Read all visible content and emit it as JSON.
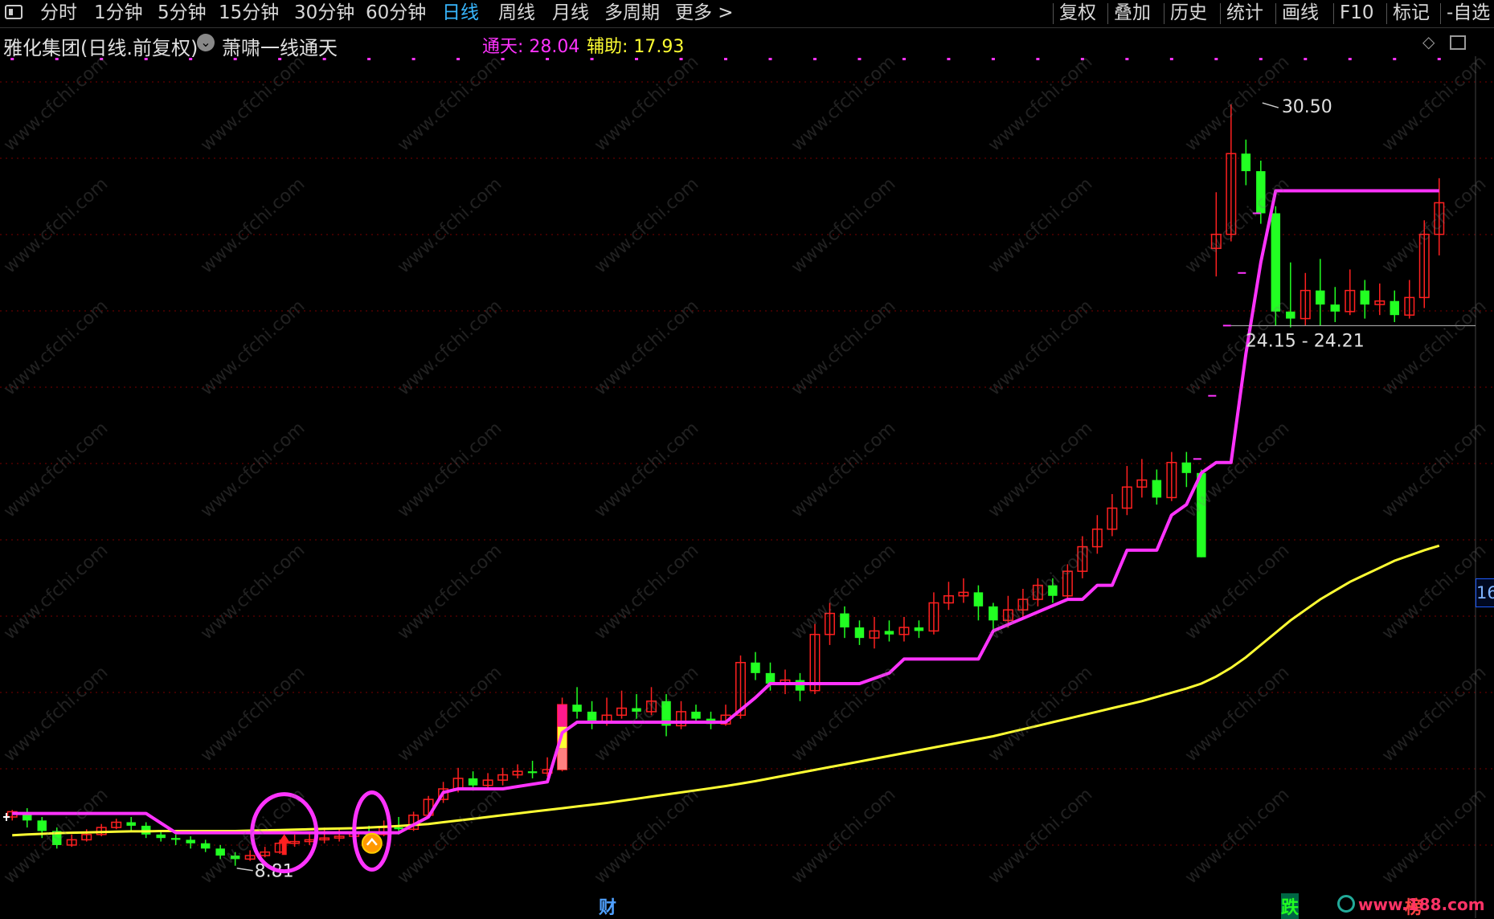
{
  "toolbar": {
    "periods": [
      "分时",
      "1分钟",
      "5分钟",
      "15分钟",
      "30分钟",
      "60分钟",
      "日线",
      "周线",
      "月线",
      "多周期",
      "更多 >"
    ],
    "active_period": "日线",
    "right_buttons": [
      "复权",
      "叠加",
      "历史",
      "统计",
      "画线",
      "F10",
      "标记",
      "-自选"
    ]
  },
  "header": {
    "stock": "雅化集团(日线.前复权)",
    "indicator": "萧啸一线通天",
    "tongtian_label": "通天: 28.04",
    "fuzhu_label": "辅助: 17.93",
    "colors": {
      "tongtian": "#ff33ff",
      "fuzhu": "#ffff33",
      "stock": "#e0e0e0"
    }
  },
  "annotations": {
    "high_label": "30.50",
    "low_label": "8.81",
    "range_label": "24.15 - 24.21",
    "right_tag": "16",
    "bottom_cai": "财",
    "bottom_die": "跌",
    "bottom_bang": "榜",
    "logo_text": "www.188.com"
  },
  "watermark": "www.cfchi.com",
  "colors": {
    "up": "#ff2020",
    "down": "#22ff22",
    "tongtian_line": "#ff33ff",
    "fuzhu_line": "#ffff33",
    "grid": "#7a0000",
    "circle": "#ff33ff"
  },
  "chart_data": {
    "type": "candlestick",
    "price_range": [
      8.81,
      30.5
    ],
    "high": 30.5,
    "low": 8.81,
    "candles": [
      {
        "o": 10.2,
        "c": 10.35,
        "h": 10.4,
        "l": 10.1
      },
      {
        "o": 10.3,
        "c": 10.1,
        "h": 10.45,
        "l": 9.9
      },
      {
        "o": 10.1,
        "c": 9.8,
        "h": 10.2,
        "l": 9.6
      },
      {
        "o": 9.8,
        "c": 9.4,
        "h": 9.9,
        "l": 9.3
      },
      {
        "o": 9.4,
        "c": 9.55,
        "h": 9.7,
        "l": 9.35
      },
      {
        "o": 9.55,
        "c": 9.7,
        "h": 9.85,
        "l": 9.5
      },
      {
        "o": 9.7,
        "c": 9.9,
        "h": 10.0,
        "l": 9.65
      },
      {
        "o": 9.9,
        "c": 10.05,
        "h": 10.15,
        "l": 9.85
      },
      {
        "o": 10.05,
        "c": 9.95,
        "h": 10.2,
        "l": 9.8
      },
      {
        "o": 9.95,
        "c": 9.7,
        "h": 10.05,
        "l": 9.6
      },
      {
        "o": 9.7,
        "c": 9.6,
        "h": 9.8,
        "l": 9.5
      },
      {
        "o": 9.6,
        "c": 9.55,
        "h": 9.7,
        "l": 9.4
      },
      {
        "o": 9.55,
        "c": 9.45,
        "h": 9.65,
        "l": 9.3
      },
      {
        "o": 9.45,
        "c": 9.3,
        "h": 9.55,
        "l": 9.2
      },
      {
        "o": 9.3,
        "c": 9.1,
        "h": 9.4,
        "l": 9.0
      },
      {
        "o": 9.1,
        "c": 9.0,
        "h": 9.2,
        "l": 8.81
      },
      {
        "o": 9.0,
        "c": 9.1,
        "h": 9.25,
        "l": 8.95
      },
      {
        "o": 9.1,
        "c": 9.2,
        "h": 9.35,
        "l": 9.05
      },
      {
        "o": 9.2,
        "c": 9.45,
        "h": 9.55,
        "l": 9.15
      },
      {
        "o": 9.45,
        "c": 9.5,
        "h": 9.7,
        "l": 9.35
      },
      {
        "o": 9.5,
        "c": 9.55,
        "h": 9.75,
        "l": 9.4
      },
      {
        "o": 9.55,
        "c": 9.6,
        "h": 9.9,
        "l": 9.45
      },
      {
        "o": 9.6,
        "c": 9.65,
        "h": 9.85,
        "l": 9.5
      },
      {
        "o": 9.65,
        "c": 9.75,
        "h": 9.95,
        "l": 9.55
      },
      {
        "o": 9.75,
        "c": 9.7,
        "h": 9.95,
        "l": 9.6
      },
      {
        "o": 9.7,
        "c": 9.9,
        "h": 10.1,
        "l": 9.65
      },
      {
        "o": 9.9,
        "c": 9.85,
        "h": 10.2,
        "l": 9.7
      },
      {
        "o": 9.85,
        "c": 10.25,
        "h": 10.35,
        "l": 9.8
      },
      {
        "o": 10.25,
        "c": 10.7,
        "h": 10.8,
        "l": 10.2
      },
      {
        "o": 10.7,
        "c": 11.0,
        "h": 11.2,
        "l": 10.6
      },
      {
        "o": 11.0,
        "c": 11.3,
        "h": 11.6,
        "l": 10.9
      },
      {
        "o": 11.3,
        "c": 11.1,
        "h": 11.5,
        "l": 10.95
      },
      {
        "o": 11.1,
        "c": 11.25,
        "h": 11.45,
        "l": 11.0
      },
      {
        "o": 11.25,
        "c": 11.4,
        "h": 11.6,
        "l": 11.1
      },
      {
        "o": 11.4,
        "c": 11.5,
        "h": 11.7,
        "l": 11.3
      },
      {
        "o": 11.5,
        "c": 11.45,
        "h": 11.8,
        "l": 11.3
      },
      {
        "o": 11.45,
        "c": 11.55,
        "h": 11.9,
        "l": 11.35
      },
      {
        "o": 11.55,
        "c": 13.4,
        "h": 13.6,
        "l": 11.5
      },
      {
        "o": 13.4,
        "c": 13.2,
        "h": 13.9,
        "l": 13.0
      },
      {
        "o": 13.2,
        "c": 12.9,
        "h": 13.5,
        "l": 12.7
      },
      {
        "o": 12.9,
        "c": 13.1,
        "h": 13.6,
        "l": 12.8
      },
      {
        "o": 13.1,
        "c": 13.3,
        "h": 13.8,
        "l": 13.0
      },
      {
        "o": 13.3,
        "c": 13.2,
        "h": 13.7,
        "l": 13.0
      },
      {
        "o": 13.2,
        "c": 13.5,
        "h": 13.9,
        "l": 13.1
      },
      {
        "o": 13.5,
        "c": 12.8,
        "h": 13.7,
        "l": 12.5
      },
      {
        "o": 12.8,
        "c": 13.2,
        "h": 13.5,
        "l": 12.7
      },
      {
        "o": 13.2,
        "c": 13.0,
        "h": 13.4,
        "l": 12.9
      },
      {
        "o": 13.0,
        "c": 12.85,
        "h": 13.2,
        "l": 12.7
      },
      {
        "o": 12.85,
        "c": 13.1,
        "h": 13.4,
        "l": 12.8
      },
      {
        "o": 13.1,
        "c": 14.6,
        "h": 14.8,
        "l": 13.0
      },
      {
        "o": 14.6,
        "c": 14.3,
        "h": 14.9,
        "l": 14.1
      },
      {
        "o": 14.3,
        "c": 14.0,
        "h": 14.6,
        "l": 13.8
      },
      {
        "o": 14.0,
        "c": 14.1,
        "h": 14.4,
        "l": 13.7
      },
      {
        "o": 14.1,
        "c": 13.8,
        "h": 14.3,
        "l": 13.5
      },
      {
        "o": 13.8,
        "c": 15.4,
        "h": 15.7,
        "l": 13.7
      },
      {
        "o": 15.4,
        "c": 16.0,
        "h": 16.3,
        "l": 15.1
      },
      {
        "o": 16.0,
        "c": 15.6,
        "h": 16.2,
        "l": 15.3
      },
      {
        "o": 15.6,
        "c": 15.3,
        "h": 15.8,
        "l": 15.1
      },
      {
        "o": 15.3,
        "c": 15.5,
        "h": 15.9,
        "l": 15.0
      },
      {
        "o": 15.5,
        "c": 15.4,
        "h": 15.8,
        "l": 15.2
      },
      {
        "o": 15.4,
        "c": 15.6,
        "h": 15.9,
        "l": 15.2
      },
      {
        "o": 15.6,
        "c": 15.5,
        "h": 15.8,
        "l": 15.3
      },
      {
        "o": 15.5,
        "c": 16.3,
        "h": 16.6,
        "l": 15.4
      },
      {
        "o": 16.3,
        "c": 16.5,
        "h": 16.9,
        "l": 16.1
      },
      {
        "o": 16.5,
        "c": 16.6,
        "h": 17.0,
        "l": 16.3
      },
      {
        "o": 16.6,
        "c": 16.2,
        "h": 16.8,
        "l": 15.8
      },
      {
        "o": 16.2,
        "c": 15.8,
        "h": 16.3,
        "l": 15.5
      },
      {
        "o": 15.8,
        "c": 16.1,
        "h": 16.5,
        "l": 15.6
      },
      {
        "o": 16.1,
        "c": 16.4,
        "h": 16.7,
        "l": 15.9
      },
      {
        "o": 16.4,
        "c": 16.8,
        "h": 17.0,
        "l": 16.2
      },
      {
        "o": 16.8,
        "c": 16.5,
        "h": 17.0,
        "l": 16.3
      },
      {
        "o": 16.5,
        "c": 17.2,
        "h": 17.4,
        "l": 16.4
      },
      {
        "o": 17.2,
        "c": 17.9,
        "h": 18.2,
        "l": 17.0
      },
      {
        "o": 17.9,
        "c": 18.4,
        "h": 18.8,
        "l": 17.7
      },
      {
        "o": 18.4,
        "c": 19.0,
        "h": 19.4,
        "l": 18.2
      },
      {
        "o": 19.0,
        "c": 19.6,
        "h": 20.2,
        "l": 18.8
      },
      {
        "o": 19.6,
        "c": 19.8,
        "h": 20.4,
        "l": 19.3
      },
      {
        "o": 19.8,
        "c": 19.3,
        "h": 20.1,
        "l": 19.1
      },
      {
        "o": 19.3,
        "c": 20.3,
        "h": 20.6,
        "l": 19.2
      },
      {
        "o": 20.3,
        "c": 20.0,
        "h": 20.6,
        "l": 19.6
      },
      {
        "o": 20.0,
        "c": 17.6,
        "h": 20.1,
        "l": 17.6
      },
      {
        "o": 26.4,
        "c": 26.8,
        "h": 28.0,
        "l": 25.6
      },
      {
        "o": 26.8,
        "c": 29.1,
        "h": 30.5,
        "l": 26.6
      },
      {
        "o": 29.1,
        "c": 28.6,
        "h": 29.5,
        "l": 28.2
      },
      {
        "o": 28.6,
        "c": 27.4,
        "h": 28.9,
        "l": 27.1
      },
      {
        "o": 27.4,
        "c": 24.6,
        "h": 27.6,
        "l": 24.2
      },
      {
        "o": 24.6,
        "c": 24.4,
        "h": 26.0,
        "l": 24.15
      },
      {
        "o": 24.4,
        "c": 25.2,
        "h": 25.7,
        "l": 24.21
      },
      {
        "o": 25.2,
        "c": 24.8,
        "h": 26.1,
        "l": 24.2
      },
      {
        "o": 24.8,
        "c": 24.6,
        "h": 25.3,
        "l": 24.3
      },
      {
        "o": 24.6,
        "c": 25.2,
        "h": 25.8,
        "l": 24.5
      },
      {
        "o": 25.2,
        "c": 24.8,
        "h": 25.5,
        "l": 24.4
      },
      {
        "o": 24.8,
        "c": 24.9,
        "h": 25.4,
        "l": 24.5
      },
      {
        "o": 24.9,
        "c": 24.5,
        "h": 25.2,
        "l": 24.3
      },
      {
        "o": 24.5,
        "c": 25.0,
        "h": 25.5,
        "l": 24.4
      },
      {
        "o": 25.0,
        "c": 26.8,
        "h": 27.2,
        "l": 24.7
      },
      {
        "o": 26.8,
        "c": 27.7,
        "h": 28.4,
        "l": 26.2
      }
    ],
    "series": [
      {
        "name": "通天",
        "color": "#ff33ff",
        "values": [
          10.3,
          10.3,
          10.3,
          10.3,
          10.3,
          10.3,
          10.3,
          10.3,
          10.3,
          10.3,
          10.3,
          10.3,
          10.3,
          10.3,
          10.3,
          10.3,
          10.3,
          10.3,
          9.75,
          9.75,
          9.75,
          9.75,
          9.75,
          9.75,
          9.75,
          9.75,
          9.75,
          9.75,
          9.75,
          9.75,
          9.75,
          9.75,
          9.75,
          9.75,
          9.75,
          9.75,
          9.75,
          9.75,
          9.75,
          9.75,
          9.75,
          9.75,
          9.75,
          9.75,
          9.75,
          9.75,
          9.75,
          9.75,
          9.75,
          9.75,
          9.75,
          9.75,
          9.75,
          9.75,
          9.75,
          9.75,
          9.75,
          9.75,
          9.75,
          9.75,
          9.75,
          9.75,
          9.75,
          9.75,
          9.75,
          9.75,
          9.75,
          9.75,
          9.75,
          9.75,
          9.75,
          9.75,
          9.75,
          9.75,
          9.75,
          9.75,
          9.75,
          9.75,
          9.75,
          9.75,
          9.75,
          9.75,
          9.75,
          9.75,
          9.75,
          9.75,
          9.75,
          9.75,
          9.75,
          9.75,
          9.75,
          9.75,
          9.75,
          9.75,
          9.75,
          9.75,
          9.75,
          9.75,
          9.75,
          9.75,
          9.75,
          9.75
        ]
      },
      {
        "name": "辅助",
        "color": "#ffff33",
        "values": [
          9.68,
          9.7,
          9.72,
          9.74,
          9.75,
          9.76,
          9.77,
          9.78,
          9.79,
          9.79,
          9.8,
          9.8,
          9.8,
          9.8,
          9.8,
          9.8,
          9.81,
          9.82,
          9.83,
          9.84,
          9.85,
          9.86,
          9.87,
          9.88,
          9.9,
          9.92,
          9.94,
          9.97,
          10.0,
          10.05,
          10.1,
          10.15,
          10.2,
          10.25,
          10.3,
          10.35,
          10.4,
          10.45,
          10.5,
          10.55,
          10.6,
          10.66,
          10.72,
          10.78,
          10.84,
          10.9,
          10.96,
          11.02,
          11.08,
          11.15,
          11.22,
          11.3,
          11.38,
          11.46,
          11.54,
          11.62,
          11.7,
          11.78,
          11.86,
          11.94,
          12.02,
          12.1,
          12.18,
          12.26,
          12.34,
          12.42,
          12.5,
          12.6,
          12.7,
          12.8,
          12.9,
          13.0,
          13.1,
          13.2,
          13.3,
          13.4,
          13.5,
          13.62,
          13.74,
          13.86,
          14.0,
          14.2,
          14.45,
          14.75,
          15.1,
          15.45,
          15.8,
          16.1,
          16.4,
          16.65,
          16.9,
          17.1,
          17.3,
          17.5,
          17.65,
          17.8,
          17.93,
          17.93,
          17.93,
          17.93,
          17.93
        ]
      }
    ],
    "tongtian_steps": [
      [
        0,
        10.3
      ],
      [
        9,
        10.3
      ],
      [
        11,
        9.75
      ],
      [
        21,
        9.75
      ],
      [
        22,
        9.75
      ],
      [
        26,
        9.75
      ],
      [
        28,
        10.2
      ],
      [
        29,
        10.9
      ],
      [
        30,
        11.0
      ],
      [
        33,
        11.0
      ],
      [
        36,
        11.2
      ],
      [
        37,
        12.6
      ],
      [
        38,
        12.9
      ],
      [
        44,
        12.9
      ],
      [
        48,
        12.9
      ],
      [
        50,
        13.6
      ],
      [
        51,
        14.0
      ],
      [
        57,
        14.0
      ],
      [
        59,
        14.3
      ],
      [
        60,
        14.7
      ],
      [
        65,
        14.7
      ],
      [
        66,
        15.5
      ],
      [
        71,
        16.4
      ],
      [
        72,
        16.4
      ],
      [
        73,
        16.8
      ],
      [
        74,
        16.8
      ],
      [
        75,
        17.8
      ],
      [
        77,
        17.8
      ],
      [
        78,
        18.8
      ],
      [
        79,
        19.1
      ],
      [
        80,
        20.0
      ],
      [
        81,
        20.3
      ],
      [
        82,
        20.3
      ],
      [
        83,
        23.4
      ],
      [
        84,
        26.0
      ],
      [
        85,
        28.04
      ],
      [
        104,
        28.04
      ]
    ],
    "xlabel": "",
    "ylabel": ""
  }
}
